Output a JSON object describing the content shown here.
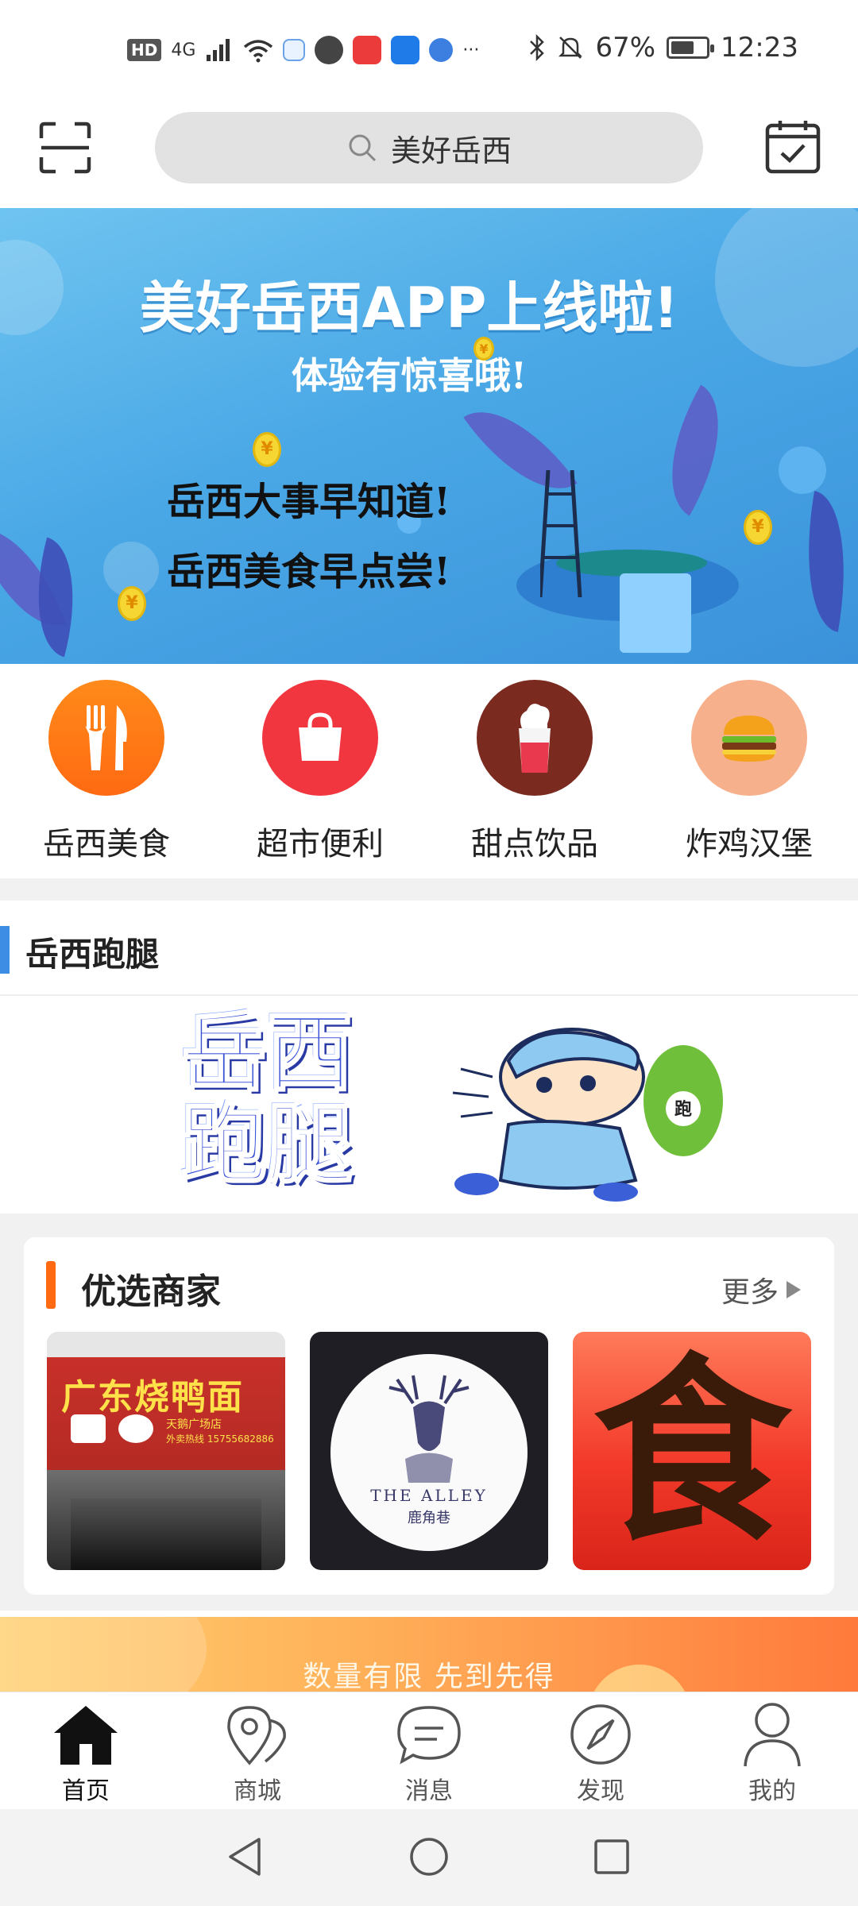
{
  "status_bar": {
    "hd": "HD",
    "network": "4G",
    "more": "···",
    "battery_text": "67%",
    "battery_level": 0.67,
    "time": "12:23"
  },
  "header": {
    "search_text": "美好岳西"
  },
  "banner": {
    "title": "美好岳西APP上线啦!",
    "subtitle": "体验有惊喜哦!",
    "line1": "岳西大事早知道!",
    "line2": "岳西美食早点尝!"
  },
  "categories": [
    {
      "label": "岳西美食",
      "icon": "fork-knife-icon",
      "color": "#ff7a14"
    },
    {
      "label": "超市便利",
      "icon": "shopping-bag-icon",
      "color": "#f23640"
    },
    {
      "label": "甜点饮品",
      "icon": "ice-cream-icon",
      "color": "#7a2a1e"
    },
    {
      "label": "炸鸡汉堡",
      "icon": "burger-icon",
      "color": "#f6b08c"
    }
  ],
  "errand": {
    "title": "岳西跑腿",
    "logo_line1": "岳西",
    "logo_line2": "跑腿",
    "bag_text": "跑"
  },
  "merchants": {
    "title": "优选商家",
    "more": "更多",
    "items": [
      {
        "name": "广东烧鸭面",
        "sub": "天鹅广场店",
        "phone": "外卖热线 15755682886"
      },
      {
        "name": "THE ALLEY",
        "sub": "鹿角巷"
      },
      {
        "name": "食"
      }
    ]
  },
  "promo": {
    "text": "数量有限 先到先得"
  },
  "bottom_nav": [
    {
      "label": "首页",
      "active": true
    },
    {
      "label": "商城",
      "active": false
    },
    {
      "label": "消息",
      "active": false
    },
    {
      "label": "发现",
      "active": false
    },
    {
      "label": "我的",
      "active": false
    }
  ],
  "colors": {
    "accent_blue": "#3d8de5",
    "accent_orange": "#ff6a13",
    "page_bg": "#f1f1f1"
  }
}
